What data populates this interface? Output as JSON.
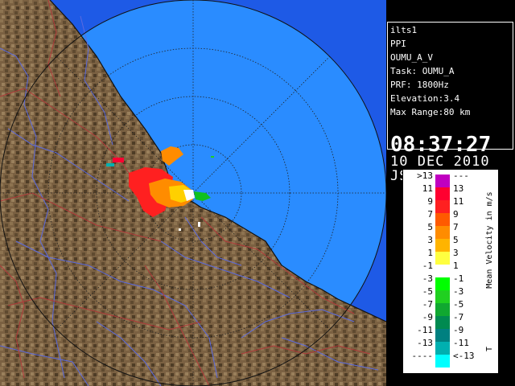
{
  "info": {
    "station": "ilts1",
    "scan_type": "PPI",
    "task_name": "OUMU_A_V",
    "task_label": "Task: OUMU_A",
    "prf": "PRF: 1800Hz",
    "elevation": "Elevation:3.4",
    "max_range": "Max Range:80 km",
    "time": "08:37:27",
    "date": "10 DEC 2010 JST"
  },
  "legend": {
    "title": "Mean Velocity in m/s",
    "top_marker": "A",
    "bottom_marker": "T",
    "rows": [
      {
        "left": ">13",
        "right": "---",
        "color": "#c000c0"
      },
      {
        "left": "11",
        "right": "13",
        "color": "#ff0030"
      },
      {
        "left": "9",
        "right": "11",
        "color": "#ff2020"
      },
      {
        "left": "7",
        "right": "9",
        "color": "#ff5a00"
      },
      {
        "left": "5",
        "right": "7",
        "color": "#ff8c00"
      },
      {
        "left": "3",
        "right": "5",
        "color": "#ffb400"
      },
      {
        "left": "1",
        "right": "3",
        "color": "#ffff40"
      },
      {
        "left": "-1",
        "right": "1",
        "color": "#ffffff"
      },
      {
        "left": "-3",
        "right": "-1",
        "color": "#00ff00"
      },
      {
        "left": "-5",
        "right": "-3",
        "color": "#20d020"
      },
      {
        "left": "-7",
        "right": "-5",
        "color": "#10a830"
      },
      {
        "left": "-9",
        "right": "-7",
        "color": "#008a50"
      },
      {
        "left": "-11",
        "right": "-9",
        "color": "#008080"
      },
      {
        "left": "-13",
        "right": "-11",
        "color": "#00b0b0"
      },
      {
        "left": "----",
        "right": "<-13",
        "color": "#00ffff"
      }
    ]
  },
  "colors": {
    "ocean_outer": "#1e5ae6",
    "ocean_inner": "#2a8cff",
    "land": "#7a6040",
    "river": "#5a6adf",
    "road": "#b03a3a"
  }
}
